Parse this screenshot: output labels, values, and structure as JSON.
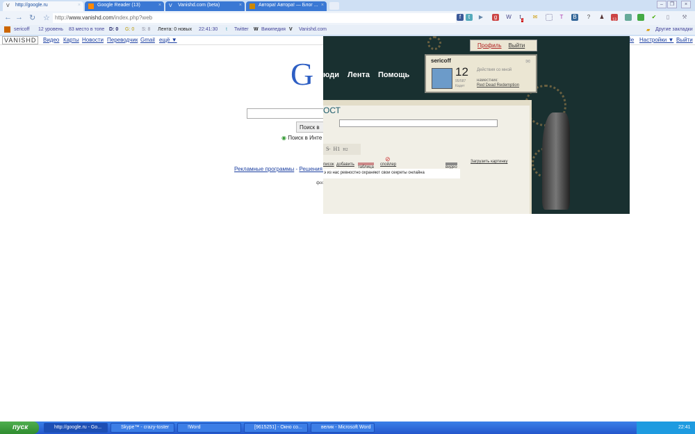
{
  "browser": {
    "tabs": [
      {
        "title": "http://google.ru",
        "active": true
      },
      {
        "title": "Google Reader (13)",
        "active": false
      },
      {
        "title": "Vanishd.com (beta)",
        "active": false
      },
      {
        "title": "Автора! Автора! — Блог ...",
        "active": false
      }
    ],
    "url_prefix": "http://",
    "url_domain": "www.vanishd.com",
    "url_path": "/index.php?web",
    "extension_badges": {
      "tumblr": "1",
      "rss": "13"
    },
    "bookmarks": {
      "user": "sericoff",
      "level": "12 уровень",
      "place": "83 место в топе",
      "d": "D: 0",
      "g": "G: 0",
      "s": "S: 8",
      "feed": "Лента: 0 новых",
      "time": "22:41:30",
      "twitter": "Twitter",
      "wiki": "Википедия",
      "vanishd": "Vanishd.com",
      "other": "Другие закладки"
    }
  },
  "google": {
    "bar_logo": "VANISHD",
    "bar_links": [
      "Видео",
      "Карты",
      "Новости",
      "Переводчик",
      "Gmail",
      "ещё ▼"
    ],
    "right_links": [
      "le",
      "Настройки ▼",
      "Выйти"
    ],
    "logo": "G",
    "search_button": "Поиск в",
    "radio_label": "Поиск в Инте",
    "links": [
      "Рекламные программы",
      "Решения д"
    ],
    "footer": "фос"
  },
  "overlay": {
    "nav": [
      "юди",
      "Лента",
      "Помощь"
    ],
    "profile_link": "Профиль",
    "logout_link": "Выйти",
    "username": "sericoff",
    "level": "12",
    "xp": "95/587",
    "rank": "Кадет",
    "actions": "Действия со мной",
    "mentor_label": "наместник:",
    "mentor": "Red Dead Redemption",
    "heading": "ост",
    "heading_sup": "1",
    "toolbar": [
      "H1",
      "H2"
    ],
    "tools": [
      "писок",
      "добавить",
      "таблица",
      "спойлер",
      "видео"
    ],
    "upload": "Загрузить картинку",
    "text": "э из нас ревностно охраняют свои секреты онлайна"
  },
  "taskbar": {
    "start": "пуск",
    "items": [
      "http://google.ru - Go...",
      "Skype™ - crazy-toster",
      "!Word",
      "[9615251] - Окно со...",
      "велик - Microsoft Word"
    ],
    "clock": "22:41"
  }
}
